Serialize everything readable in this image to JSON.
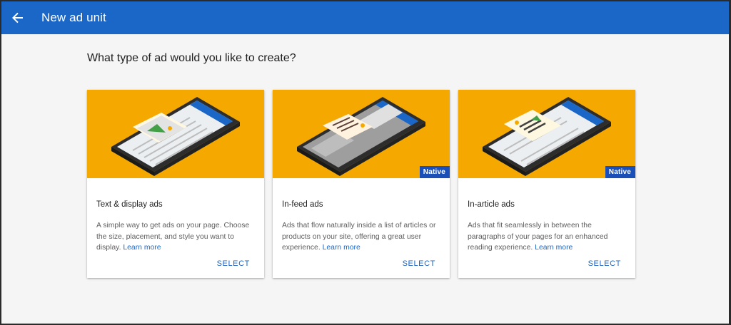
{
  "appbar": {
    "title": "New ad unit",
    "back_icon": "arrow-left-icon",
    "color": "#1a67c7"
  },
  "main": {
    "heading": "What type of ad would you like to create?"
  },
  "cards": [
    {
      "title": "Text & display ads",
      "description": "A simple way to get ads on your page. Choose the size, placement, and style you want to display.",
      "learn_more": "Learn more",
      "select": "SELECT",
      "badge": ""
    },
    {
      "title": "In-feed ads",
      "description": "Ads that flow naturally inside a list of articles or products on your site, offering a great user experience.",
      "learn_more": "Learn more",
      "select": "SELECT",
      "badge": "Native"
    },
    {
      "title": "In-article ads",
      "description": "Ads that fit seamlessly in between the paragraphs of your pages for an enhanced reading experience.",
      "learn_more": "Learn more",
      "select": "SELECT",
      "badge": "Native"
    }
  ],
  "colors": {
    "hero_bg": "#f5a800",
    "badge_bg": "#1a4fb7",
    "link": "#1a67c7"
  }
}
